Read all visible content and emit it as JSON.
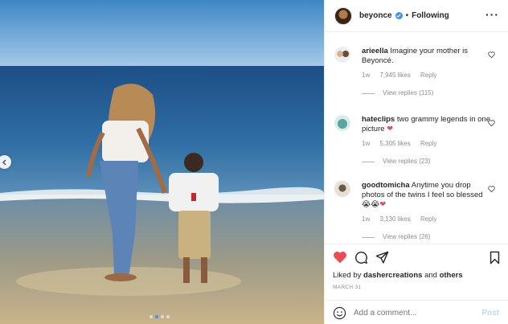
{
  "post": {
    "username": "beyonce",
    "follow_state": "Following",
    "separator": "•",
    "carousel_dots": 4,
    "carousel_active": 2
  },
  "comments": [
    {
      "user": "arieella",
      "text": "Imagine your mother is Beyoncé.",
      "time": "1w",
      "likes": "7,945 likes",
      "reply": "Reply",
      "view_replies": "View replies (115)"
    },
    {
      "user": "hateclips",
      "text": "two grammy legends in one picture ❤",
      "time": "1w",
      "likes": "5,305 likes",
      "reply": "Reply",
      "view_replies": "View replies (23)"
    },
    {
      "user": "goodtomicha",
      "text": "Anytime you drop photos of the twins I feel so blessed 😭😭❤",
      "time": "1w",
      "likes": "3,130 likes",
      "reply": "Reply",
      "view_replies": "View replies (26)"
    }
  ],
  "footer": {
    "liked_by_prefix": "Liked by",
    "liked_by_user": "dashercreations",
    "liked_by_and": "and",
    "liked_by_others": "others",
    "date": "MARCH 31",
    "comment_placeholder": "Add a comment...",
    "post_label": "Post"
  },
  "colors": {
    "accent": "#3897f0",
    "like_red": "#ed4956",
    "muted": "#8e8e8e",
    "post_disabled": "#b2dffc"
  }
}
